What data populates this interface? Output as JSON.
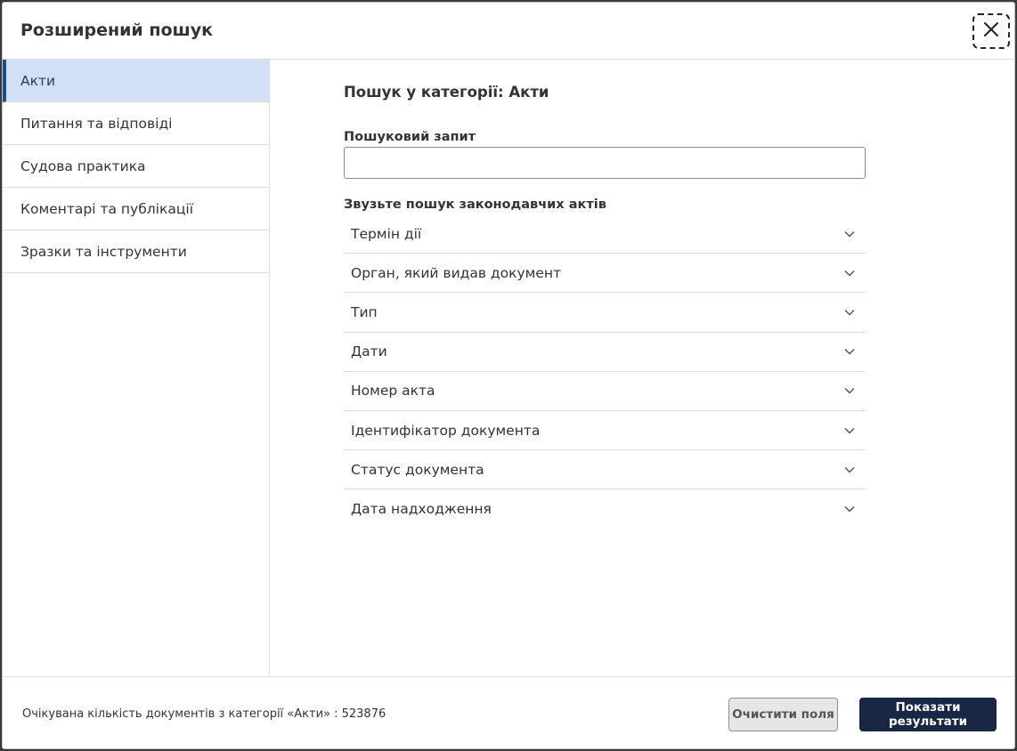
{
  "modal": {
    "title": "Розширений пошук",
    "close_icon": "close-icon"
  },
  "sidebar": {
    "items": [
      {
        "label": "Акти",
        "active": true
      },
      {
        "label": "Питання та відповіді",
        "active": false
      },
      {
        "label": "Судова практика",
        "active": false
      },
      {
        "label": "Коментарі та публікації",
        "active": false
      },
      {
        "label": "Зразки та інструменти",
        "active": false
      }
    ]
  },
  "main": {
    "section_title": "Пошук у категорії: Акти",
    "search": {
      "label": "Пошуковий запит",
      "value": "",
      "placeholder": ""
    },
    "narrow_label": "Звузьте пошук законодавчих актів",
    "filters": [
      {
        "label": "Термін дії",
        "icon": "chevron-down-icon"
      },
      {
        "label": "Орган, який видав документ",
        "icon": "chevron-down-icon"
      },
      {
        "label": "Тип",
        "icon": "chevron-down-icon"
      },
      {
        "label": "Дати",
        "icon": "chevron-down-icon"
      },
      {
        "label": "Номер акта",
        "icon": "chevron-down-icon"
      },
      {
        "label": "Ідентифікатор документа",
        "icon": "chevron-down-icon"
      },
      {
        "label": "Статус документа",
        "icon": "chevron-down-icon"
      },
      {
        "label": "Дата надходження",
        "icon": "chevron-down-icon"
      }
    ]
  },
  "footer": {
    "count_text": "Очікувана кількість документів з категорії «Акти» : 523876",
    "clear_label": "Очистити поля",
    "show_label": "Показати результати"
  },
  "colors": {
    "accent": "#1d4f91",
    "active_bg": "#d1e0f4",
    "primary_button": "#1a2744"
  }
}
